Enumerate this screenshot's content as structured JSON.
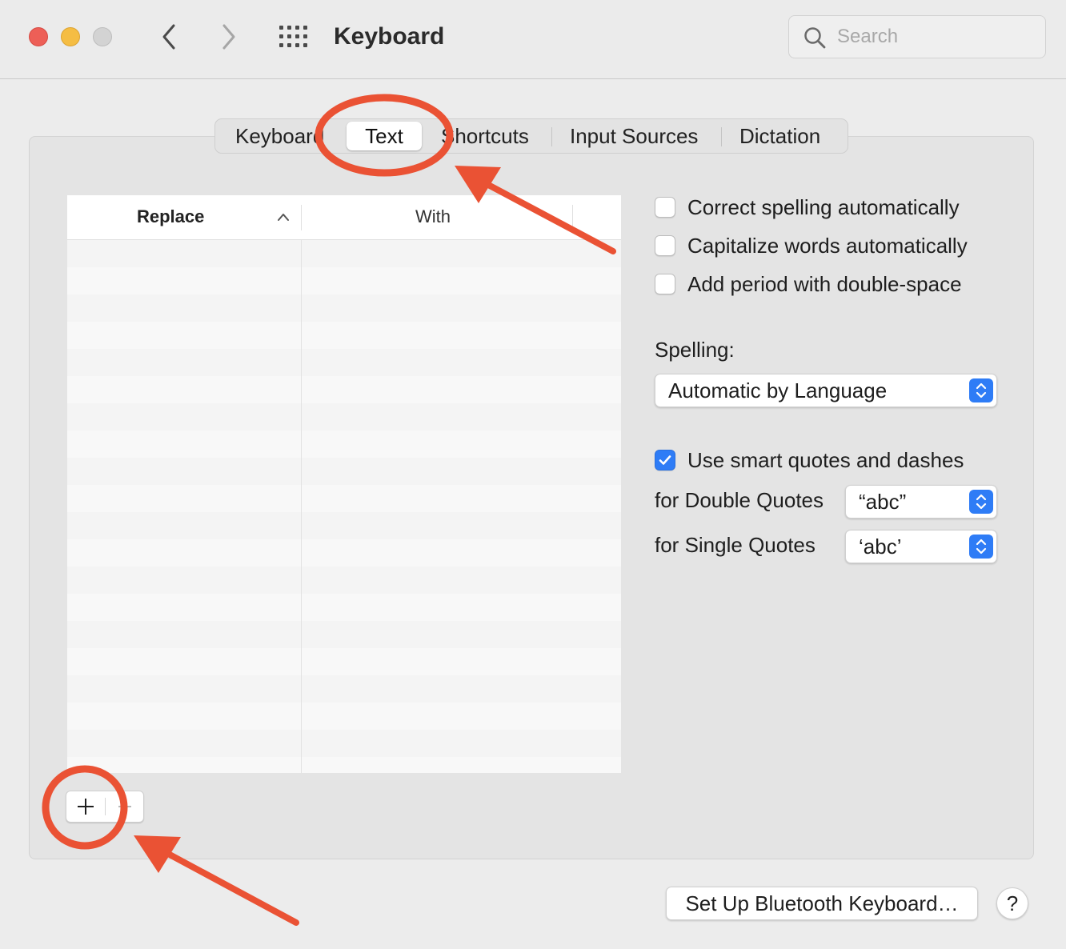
{
  "window": {
    "title": "Keyboard",
    "back_icon": "chevron-left-icon",
    "forward_icon": "chevron-right-icon",
    "show_all_icon": "grid-icon"
  },
  "search": {
    "placeholder": "Search",
    "icon": "search-icon"
  },
  "tabs": [
    {
      "label": "Keyboard",
      "selected": false
    },
    {
      "label": "Text",
      "selected": true
    },
    {
      "label": "Shortcuts",
      "selected": false
    },
    {
      "label": "Input Sources",
      "selected": false
    },
    {
      "label": "Dictation",
      "selected": false
    }
  ],
  "table": {
    "columns": [
      {
        "label": "Replace",
        "sort": "ascending"
      },
      {
        "label": "With"
      }
    ],
    "rows": []
  },
  "table_controls": {
    "add_label": "+",
    "remove_label": "−"
  },
  "options": {
    "correct_spelling": {
      "label": "Correct spelling automatically",
      "checked": false
    },
    "capitalize_words": {
      "label": "Capitalize words automatically",
      "checked": false
    },
    "add_period": {
      "label": "Add period with double-space",
      "checked": false
    }
  },
  "spelling": {
    "label": "Spelling:",
    "value": "Automatic by Language"
  },
  "smart_quotes": {
    "label": "Use smart quotes and dashes",
    "checked": true,
    "double": {
      "label": "for Double Quotes",
      "value": "“abc”"
    },
    "single": {
      "label": "for Single Quotes",
      "value": "‘abc’"
    }
  },
  "footer": {
    "bluetooth_button": "Set Up Bluetooth Keyboard…",
    "help_button": "?"
  },
  "colors": {
    "accent": "#2e7cf6",
    "annotation": "#ea5234",
    "background": "#ececec"
  }
}
